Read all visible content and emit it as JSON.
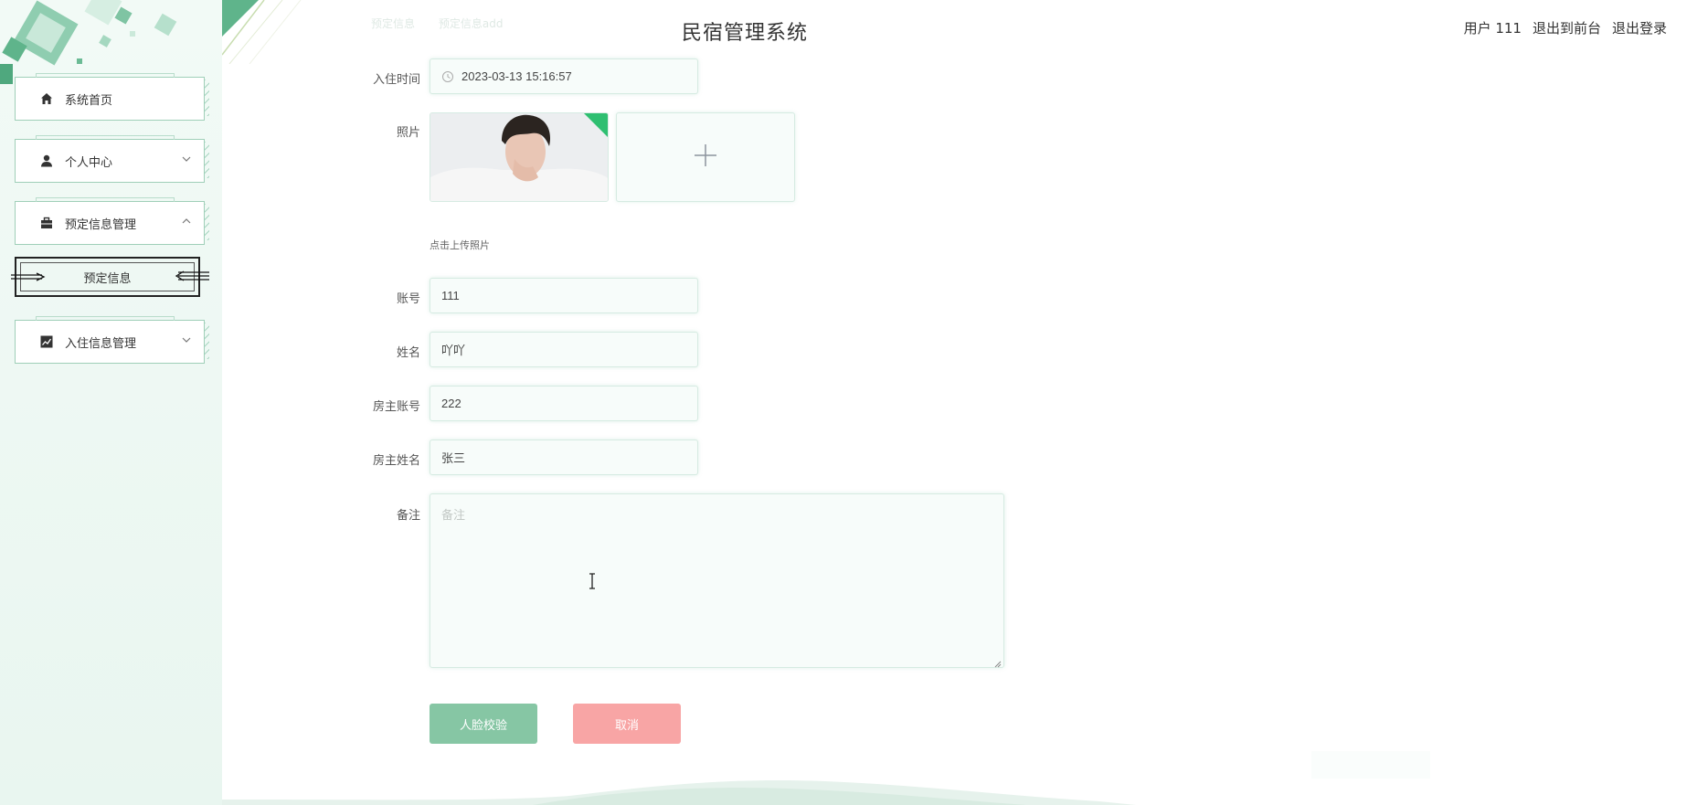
{
  "app_title": "民宿管理系统",
  "faint_tabs": [
    "预定信息",
    "预定信息add"
  ],
  "header": {
    "user_label": "用户 111",
    "front_label": "退出到前台",
    "logout_label": "退出登录"
  },
  "sidebar": {
    "items": [
      {
        "label": "系统首页",
        "icon": "home-icon"
      },
      {
        "label": "个人中心",
        "icon": "user-icon",
        "expanded": false
      },
      {
        "label": "预定信息管理",
        "icon": "briefcase-icon",
        "expanded": true
      },
      {
        "label": "入住信息管理",
        "icon": "chart-icon",
        "expanded": false
      }
    ],
    "submenu": {
      "label": "预定信息"
    }
  },
  "form": {
    "checkin_time": {
      "label": "入住时间",
      "value": "2023-03-13 15:16:57"
    },
    "photo": {
      "label": "照片",
      "hint": "点击上传照片"
    },
    "account": {
      "label": "账号",
      "value": "111"
    },
    "name": {
      "label": "姓名",
      "value": "吖吖"
    },
    "owner_account": {
      "label": "房主账号",
      "value": "222"
    },
    "owner_name": {
      "label": "房主姓名",
      "value": "张三"
    },
    "remark": {
      "label": "备注",
      "placeholder": "备注"
    }
  },
  "buttons": {
    "face_check": "人脸校验",
    "cancel": "取消"
  },
  "colors": {
    "accent": "#86c6a4",
    "danger": "#f8a5a5",
    "badge": "#2fbf71"
  }
}
